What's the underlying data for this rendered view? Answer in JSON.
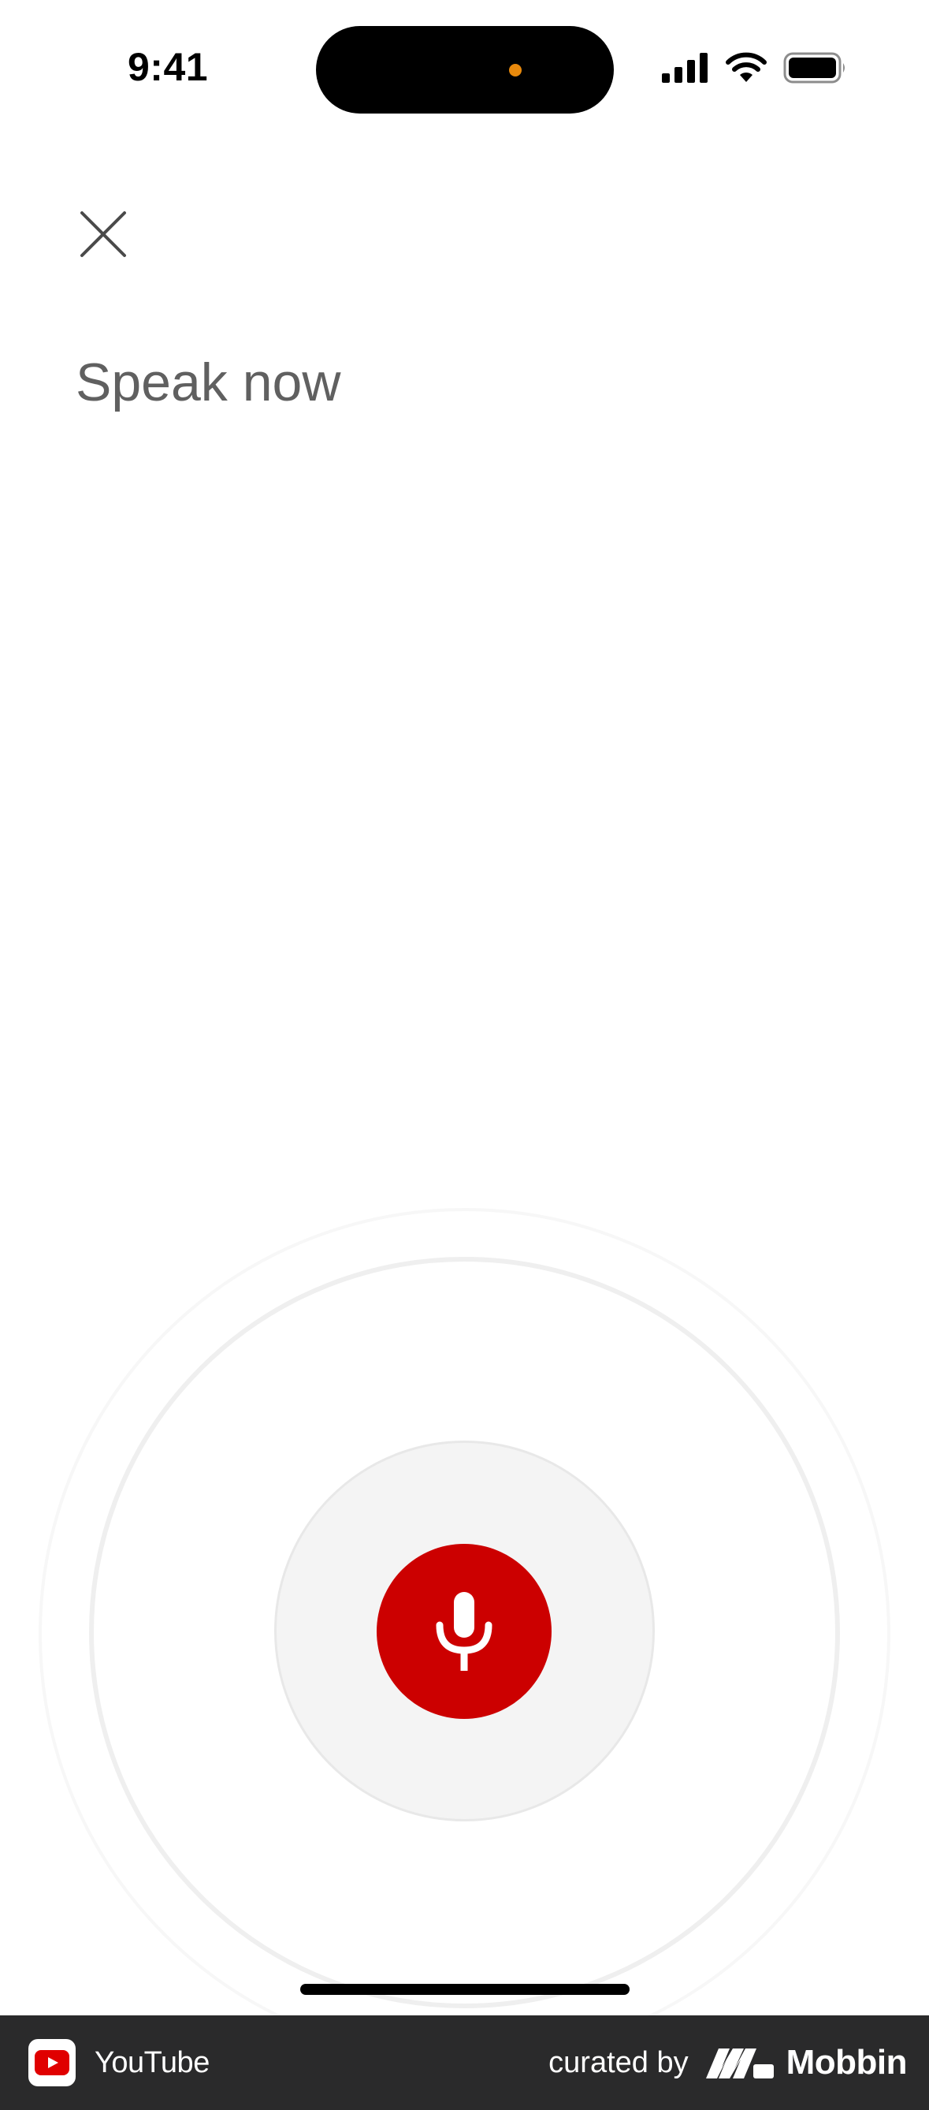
{
  "status_bar": {
    "time": "9:41",
    "icons": [
      "cellular-signal-icon",
      "wifi-icon",
      "battery-icon"
    ]
  },
  "header": {
    "close_icon": "close-icon"
  },
  "voice_search": {
    "prompt": "Speak now",
    "mic_icon": "microphone-icon",
    "accent_color": "#cc0000"
  },
  "footer": {
    "app_name": "YouTube",
    "curated_label": "curated by",
    "brand_name": "Mobbin"
  }
}
